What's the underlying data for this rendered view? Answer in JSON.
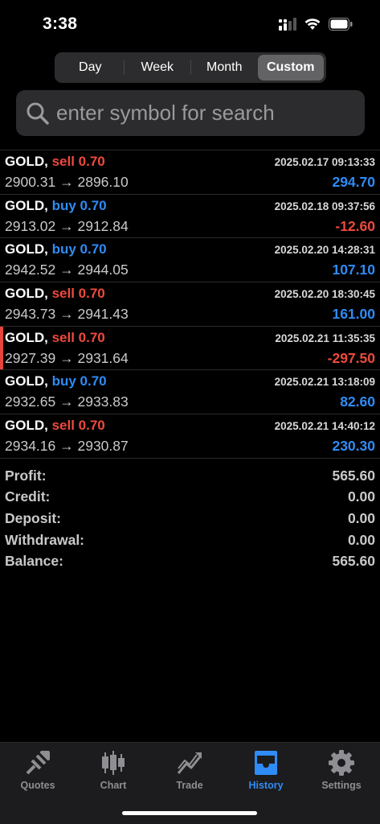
{
  "status": {
    "time": "3:38"
  },
  "segmented": {
    "items": [
      {
        "label": "Day",
        "active": false
      },
      {
        "label": "Week",
        "active": false
      },
      {
        "label": "Month",
        "active": false
      },
      {
        "label": "Custom",
        "active": true
      }
    ]
  },
  "search": {
    "placeholder": "enter symbol for search"
  },
  "trades": [
    {
      "symbol": "GOLD,",
      "side": "sell 0.70",
      "type": "sell",
      "datetime": "2025.02.17 09:13:33",
      "prices": "2900.31 → 2896.10",
      "profit": "294.70",
      "sign": "pos",
      "marked": false
    },
    {
      "symbol": "GOLD,",
      "side": "buy 0.70",
      "type": "buy",
      "datetime": "2025.02.18 09:37:56",
      "prices": "2913.02 → 2912.84",
      "profit": "-12.60",
      "sign": "neg",
      "marked": false
    },
    {
      "symbol": "GOLD,",
      "side": "buy 0.70",
      "type": "buy",
      "datetime": "2025.02.20 14:28:31",
      "prices": "2942.52 → 2944.05",
      "profit": "107.10",
      "sign": "pos",
      "marked": false
    },
    {
      "symbol": "GOLD,",
      "side": "sell 0.70",
      "type": "sell",
      "datetime": "2025.02.20 18:30:45",
      "prices": "2943.73 → 2941.43",
      "profit": "161.00",
      "sign": "pos",
      "marked": false
    },
    {
      "symbol": "GOLD,",
      "side": "sell 0.70",
      "type": "sell",
      "datetime": "2025.02.21 11:35:35",
      "prices": "2927.39 → 2931.64",
      "profit": "-297.50",
      "sign": "neg",
      "marked": true
    },
    {
      "symbol": "GOLD,",
      "side": "buy 0.70",
      "type": "buy",
      "datetime": "2025.02.21 13:18:09",
      "prices": "2932.65 → 2933.83",
      "profit": "82.60",
      "sign": "pos",
      "marked": false
    },
    {
      "symbol": "GOLD,",
      "side": "sell 0.70",
      "type": "sell",
      "datetime": "2025.02.21 14:40:12",
      "prices": "2934.16 → 2930.87",
      "profit": "230.30",
      "sign": "pos",
      "marked": false
    }
  ],
  "summary": {
    "profit": {
      "label": "Profit:",
      "value": "565.60"
    },
    "credit": {
      "label": "Credit:",
      "value": "0.00"
    },
    "deposit": {
      "label": "Deposit:",
      "value": "0.00"
    },
    "withdrawal": {
      "label": "Withdrawal:",
      "value": "0.00"
    },
    "balance": {
      "label": "Balance:",
      "value": "565.60"
    }
  },
  "tabbar": {
    "items": [
      {
        "label": "Quotes",
        "icon": "quotes-icon",
        "active": false
      },
      {
        "label": "Chart",
        "icon": "candlestick-chart-icon",
        "active": false
      },
      {
        "label": "Trade",
        "icon": "trade-icon",
        "active": false
      },
      {
        "label": "History",
        "icon": "history-inbox-icon",
        "active": true
      },
      {
        "label": "Settings",
        "icon": "gear-icon",
        "active": false
      }
    ]
  },
  "colors": {
    "accent": "#2f8cf6",
    "sell": "#ee4a3c",
    "background": "#000000"
  }
}
